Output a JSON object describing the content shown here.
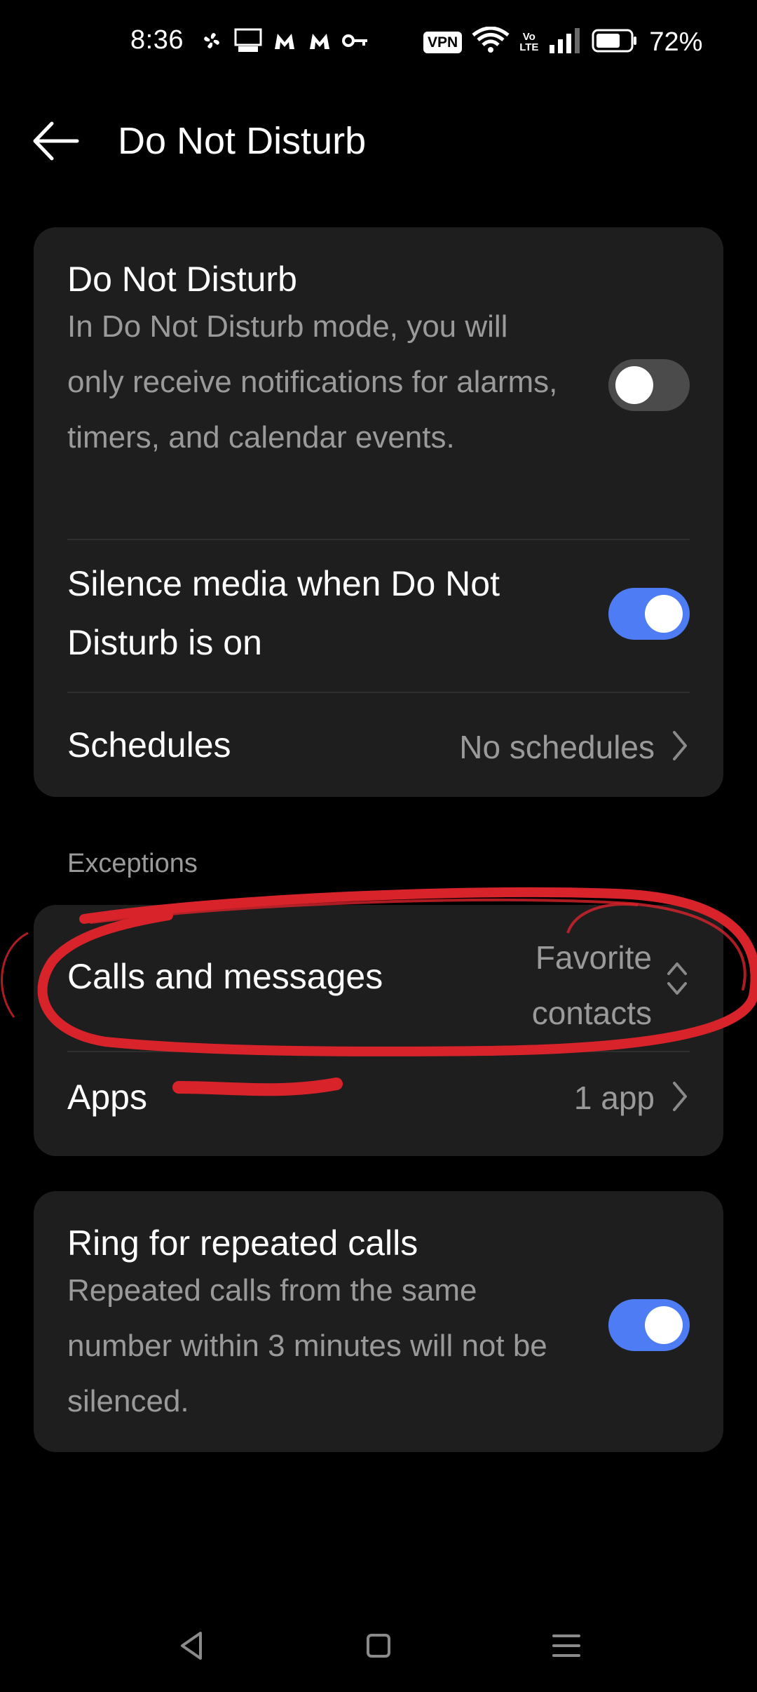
{
  "status_bar": {
    "time": "8:36",
    "left_icons": [
      "pinwheel-icon",
      "fox-business-icon",
      "malwarebytes-icon",
      "malwarebytes-icon",
      "vpn-key-icon"
    ],
    "vpn_label": "VPN",
    "volte_top": "Vo",
    "volte_bottom": "LTE",
    "battery_percent": "72%"
  },
  "header": {
    "title": "Do Not Disturb"
  },
  "main_card": {
    "dnd": {
      "title": "Do Not Disturb",
      "description": "In Do Not Disturb mode, you will only receive notifications for alarms, timers, and calendar events.",
      "enabled": false
    },
    "silence_media": {
      "title": "Silence media when Do Not Disturb is on",
      "enabled": true
    },
    "schedules": {
      "title": "Schedules",
      "value": "No schedules"
    }
  },
  "exceptions": {
    "section_label": "Exceptions",
    "calls_messages": {
      "title": "Calls and messages",
      "value": "Favorite contacts"
    },
    "apps": {
      "title": "Apps",
      "value": "1 app"
    }
  },
  "repeat_calls": {
    "title": "Ring for repeated calls",
    "description": "Repeated calls from the same number within 3 minutes will not be silenced.",
    "enabled": true
  },
  "colors": {
    "background": "#000000",
    "card": "#1e1e1e",
    "accent": "#4d7cf4",
    "annotation": "#d8232a"
  },
  "nav_bar": [
    "back-icon",
    "home-icon",
    "recents-icon"
  ]
}
